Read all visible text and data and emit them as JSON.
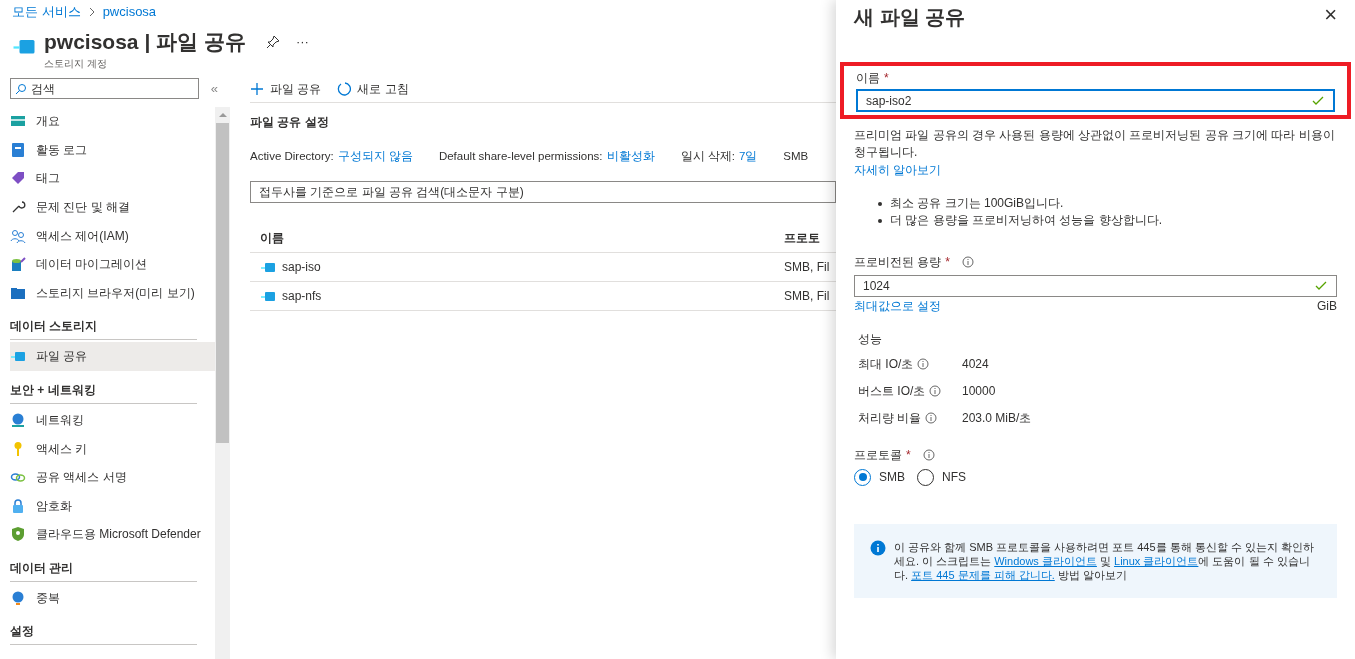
{
  "breadcrumb": [
    {
      "label": "모든 서비스"
    },
    {
      "label": "pwcisosa"
    }
  ],
  "header": {
    "title": "pwcisosa | 파일 공유",
    "subtitle": "스토리지 계정",
    "more": "···"
  },
  "sidebar": {
    "search_placeholder": "검색",
    "collapse": "«",
    "items": [
      {
        "kind": "item",
        "label": "개요",
        "selected": false
      },
      {
        "kind": "item",
        "label": "활동 로그",
        "selected": false
      },
      {
        "kind": "item",
        "label": "태그",
        "selected": false
      },
      {
        "kind": "item",
        "label": "문제 진단 및 해결",
        "selected": false
      },
      {
        "kind": "item",
        "label": "액세스 제어(IAM)",
        "selected": false
      },
      {
        "kind": "item",
        "label": "데이터 마이그레이션",
        "selected": false
      },
      {
        "kind": "item",
        "label": "스토리지 브라우저(미리 보기)",
        "selected": false
      },
      {
        "kind": "section",
        "label": "데이터 스토리지"
      },
      {
        "kind": "item",
        "label": "파일 공유",
        "selected": true
      },
      {
        "kind": "section",
        "label": "보안 + 네트워킹"
      },
      {
        "kind": "item",
        "label": "네트워킹",
        "selected": false
      },
      {
        "kind": "item",
        "label": "액세스 키",
        "selected": false
      },
      {
        "kind": "item",
        "label": "공유 액세스 서명",
        "selected": false
      },
      {
        "kind": "item",
        "label": "암호화",
        "selected": false
      },
      {
        "kind": "item",
        "label": "클라우드용 Microsoft Defender",
        "selected": false
      },
      {
        "kind": "section",
        "label": "데이터 관리"
      },
      {
        "kind": "item",
        "label": "중복",
        "selected": false
      },
      {
        "kind": "section",
        "label": "설정"
      }
    ]
  },
  "toolbar": [
    {
      "kind": "add",
      "label": "파일 공유"
    },
    {
      "kind": "refresh",
      "label": "새로 고침"
    }
  ],
  "settings": {
    "title": "파일 공유 설정",
    "entries": [
      {
        "label": "Active Directory:",
        "value": "구성되지 않음"
      },
      {
        "label": "Default share-level permissions:",
        "value": "비활성화"
      },
      {
        "label": "일시 삭제:",
        "value": "7일"
      },
      {
        "label": "SMB"
      }
    ]
  },
  "filter": {
    "placeholder": "접두사를 기준으로 파일 공유 검색(대소문자 구분)"
  },
  "table": {
    "columns": [
      "이름",
      "프로토"
    ],
    "rows": [
      [
        "sap-iso",
        "SMB, Fil"
      ],
      [
        "sap-nfs",
        "SMB, Fil"
      ]
    ]
  },
  "panel": {
    "title": "새 파일 공유",
    "close": "×",
    "name_field": {
      "label": "이름",
      "required": "*",
      "value": "sap-iso2",
      "valid": true,
      "highlighted": true
    },
    "note": "프리미엄 파일 공유의 경우 사용된 용량에 상관없이 프로비저닝된 공유 크기에 따라 비용이 청구됩니다.",
    "learn_more": "자세히 알아보기",
    "bullets": [
      "최소 공유 크기는 100GiB입니다.",
      "더 많은 용량을 프로비저닝하여 성능을 향상합니다."
    ],
    "capacity": {
      "label": "프로비전된 용량",
      "required": "*",
      "value": "1024",
      "valid": true,
      "max_link": "최대값으로 설정",
      "unit": "GiB"
    },
    "performance": {
      "title": "성능",
      "rows": [
        {
          "label": "최대 IO/초",
          "value": "4024"
        },
        {
          "label": "버스트 IO/초",
          "value": "10000"
        },
        {
          "label": "처리량 비율",
          "value": "203.0 MiB/초"
        }
      ]
    },
    "protocol": {
      "label": "프로토콜",
      "required": "*",
      "options": [
        {
          "label": "SMB",
          "selected": true
        },
        {
          "label": "NFS",
          "selected": false
        }
      ]
    },
    "info": [
      {
        "kind": "text",
        "text": "이 공유와 함께 SMB 프로토콜을 사용하려면 포트 445를 통해 통신할 수 있는지 확인하세요. 이 스크립트는 "
      },
      {
        "kind": "link",
        "text": "Windows 클라이언트"
      },
      {
        "kind": "text",
        "text": " 및 "
      },
      {
        "kind": "link",
        "text": "Linux 클라이언트"
      },
      {
        "kind": "text",
        "text": "에 도움이 될 수 있습니다. "
      },
      {
        "kind": "link",
        "text": "포트 445 문제를 피해 갑니다."
      },
      {
        "kind": "text",
        "text": " 방법 알아보기"
      }
    ]
  }
}
